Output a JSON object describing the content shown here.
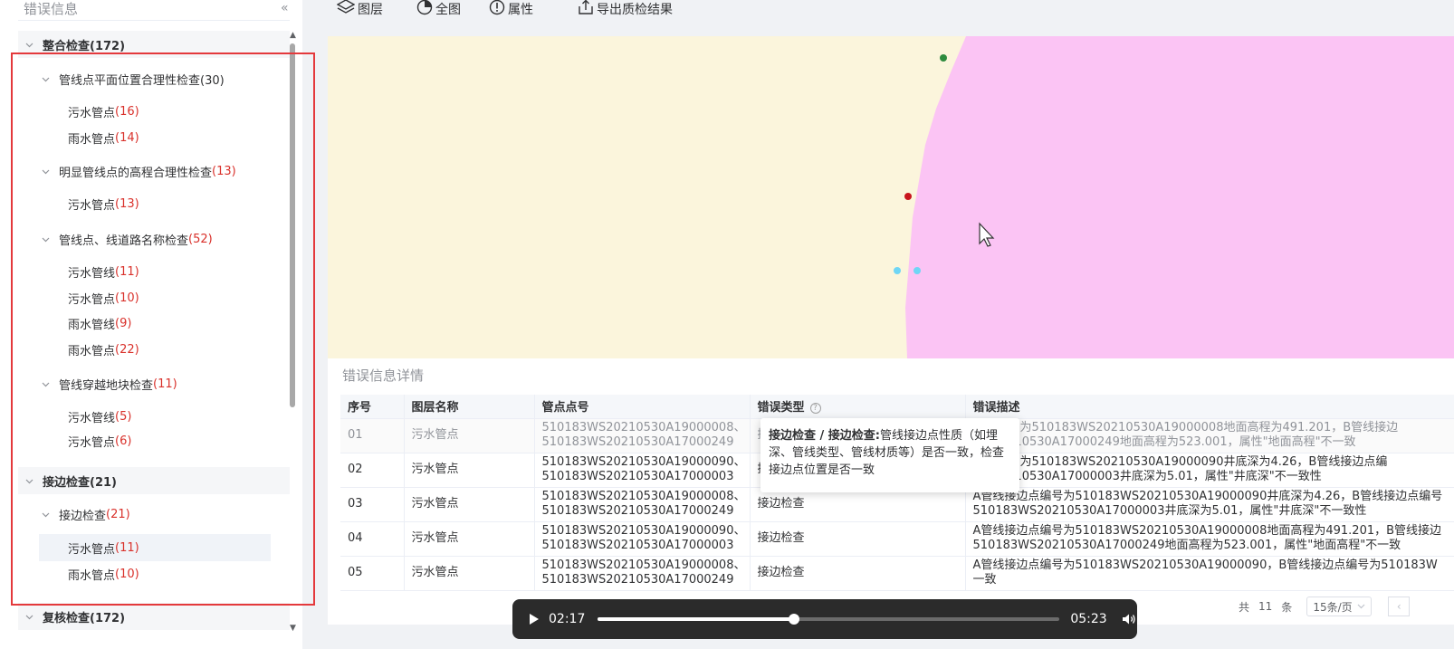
{
  "sidebar": {
    "title": "错误信息",
    "collapse_icon": "«",
    "tree": [
      {
        "label": "整合检查(172)",
        "count": ""
      },
      {
        "label": "管线点平面位置合理性检查(30)",
        "count": ""
      },
      {
        "label": "污水管点",
        "count": "(16)"
      },
      {
        "label": "雨水管点",
        "count": "(14)"
      },
      {
        "label": "明显管线点的高程合理性检查",
        "count": "(13)"
      },
      {
        "label": "污水管点",
        "count": "(13)"
      },
      {
        "label": "管线点、线道路名称检查",
        "count": "(52)"
      },
      {
        "label": "污水管线",
        "count": "(11)"
      },
      {
        "label": "污水管点",
        "count": "(10)"
      },
      {
        "label": "雨水管线",
        "count": "(9)"
      },
      {
        "label": "雨水管点",
        "count": "(22)"
      },
      {
        "label": "管线穿越地块检查",
        "count": "(11)"
      },
      {
        "label": "污水管线",
        "count": "(5)"
      },
      {
        "label": "污水管点",
        "count": "(6)"
      },
      {
        "label": "接边检查(21)",
        "count": ""
      },
      {
        "label": "接边检查",
        "count": "(21)"
      },
      {
        "label": "污水管点",
        "count": "(11)"
      },
      {
        "label": "雨水管点",
        "count": "(10)"
      },
      {
        "label": "复核检查(172)",
        "count": ""
      }
    ]
  },
  "toolbar": {
    "layers": "图层",
    "full_extent": "全图",
    "attributes": "属性",
    "export": "导出质检结果"
  },
  "map": {
    "background_color": "#fbf5dc",
    "region_color": "#fbc4f4"
  },
  "detail": {
    "title": "错误信息详情",
    "columns": [
      "序号",
      "图层名称",
      "管点点号",
      "错误类型",
      "错误描述"
    ],
    "rows": [
      {
        "no": "01",
        "layer": "污水管点",
        "pt1": "510183WS20210530A19000008、",
        "pt2": "510183WS20210530A17000249",
        "type": "接",
        "d1": "边点编号为510183WS20210530A19000008地面高程为491.201，B管线接边",
        "d2": "WS20210530A17000249地面高程为523.001，属性\"地面高程\"不一致"
      },
      {
        "no": "02",
        "layer": "污水管点",
        "pt1": "510183WS20210530A19000090、",
        "pt2": "510183WS20210530A17000003",
        "type": "接",
        "d1": "边点编号为510183WS20210530A19000090井底深为4.26，B管线接边点编",
        "d2": "WS20210530A17000003井底深为5.01，属性\"井底深\"不一致性"
      },
      {
        "no": "03",
        "layer": "污水管点",
        "pt1": "510183WS20210530A19000008、",
        "pt2": "510183WS20210530A17000249",
        "type": "接边检查",
        "d1": "A管线接边点编号为510183WS20210530A19000090井底深为4.26，B管线接边点编号",
        "d2": "510183WS20210530A17000003井底深为5.01，属性\"井底深\"不一致性"
      },
      {
        "no": "04",
        "layer": "污水管点",
        "pt1": "510183WS20210530A19000090、",
        "pt2": "510183WS20210530A17000003",
        "type": "接边检查",
        "d1": "A管线接边点编号为510183WS20210530A19000008地面高程为491.201，B管线接边",
        "d2": "510183WS20210530A17000249地面高程为523.001，属性\"地面高程\"不一致"
      },
      {
        "no": "05",
        "layer": "污水管点",
        "pt1": "510183WS20210530A19000008、",
        "pt2": "510183WS20210530A17000249",
        "type": "接边检查",
        "d1": "A管线接边点编号为510183WS20210530A19000090，B管线接边点编号为510183W",
        "d2": "一致"
      }
    ],
    "tooltip_title": "接边检查 / 接边检查:",
    "tooltip_text": "管线接边点性质（如埋深、管线类型、管线材质等）是否一致，检查接边点位置是否一致"
  },
  "pager": {
    "total_prefix": "共",
    "total": "11",
    "total_suffix": "条",
    "page_size": "15条/页"
  },
  "player": {
    "current": "02:17",
    "total": "05:23",
    "progress": 0.424
  }
}
